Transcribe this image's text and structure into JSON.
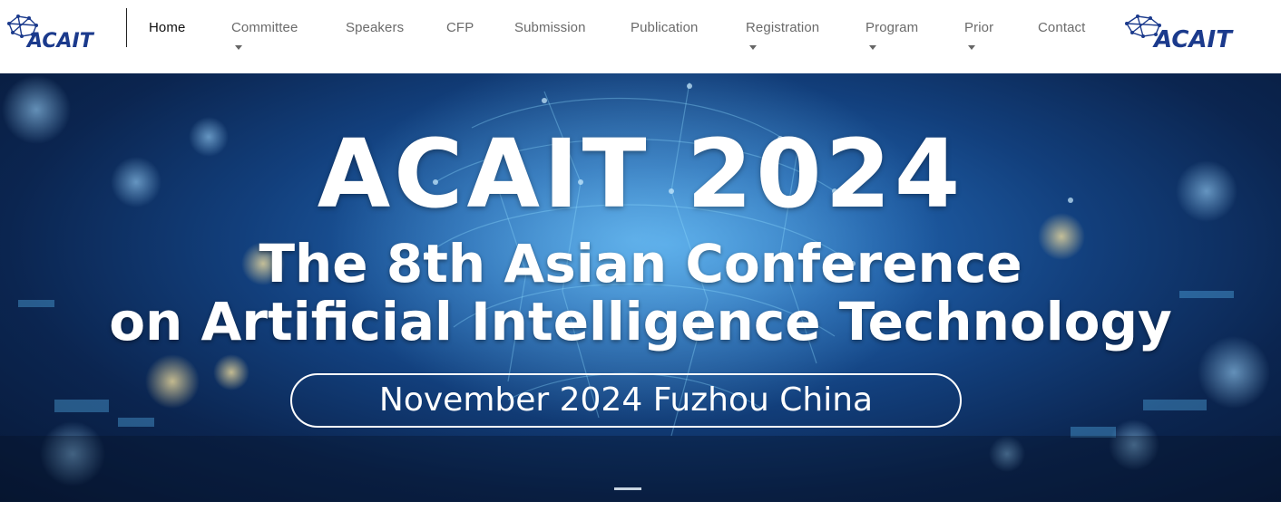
{
  "brand": {
    "logo_text": "ACAIT",
    "logo_color": "#1b3a8c"
  },
  "nav": {
    "items": [
      {
        "label": "Home",
        "active": true,
        "dropdown": false
      },
      {
        "label": "Committee",
        "active": false,
        "dropdown": true
      },
      {
        "label": "Speakers",
        "active": false,
        "dropdown": false
      },
      {
        "label": "CFP",
        "active": false,
        "dropdown": false
      },
      {
        "label": "Submission",
        "active": false,
        "dropdown": false
      },
      {
        "label": "Publication",
        "active": false,
        "dropdown": false
      },
      {
        "label": "Registration",
        "active": false,
        "dropdown": true
      },
      {
        "label": "Program",
        "active": false,
        "dropdown": true
      },
      {
        "label": "Prior",
        "active": false,
        "dropdown": true
      },
      {
        "label": "Contact",
        "active": false,
        "dropdown": false
      }
    ]
  },
  "hero": {
    "title": "ACAIT  2024",
    "subtitle_line1": "The 8th Asian Conference",
    "subtitle_line2": "on Artificial Intelligence Technology",
    "date_location": "November 2024  Fuzhou China",
    "slide_index": 1,
    "slide_count": 1
  },
  "colors": {
    "hero_dark": "#0b2550",
    "hero_light": "#3d8fd6",
    "nav_text": "#6b6b6b",
    "nav_active": "#111111"
  }
}
